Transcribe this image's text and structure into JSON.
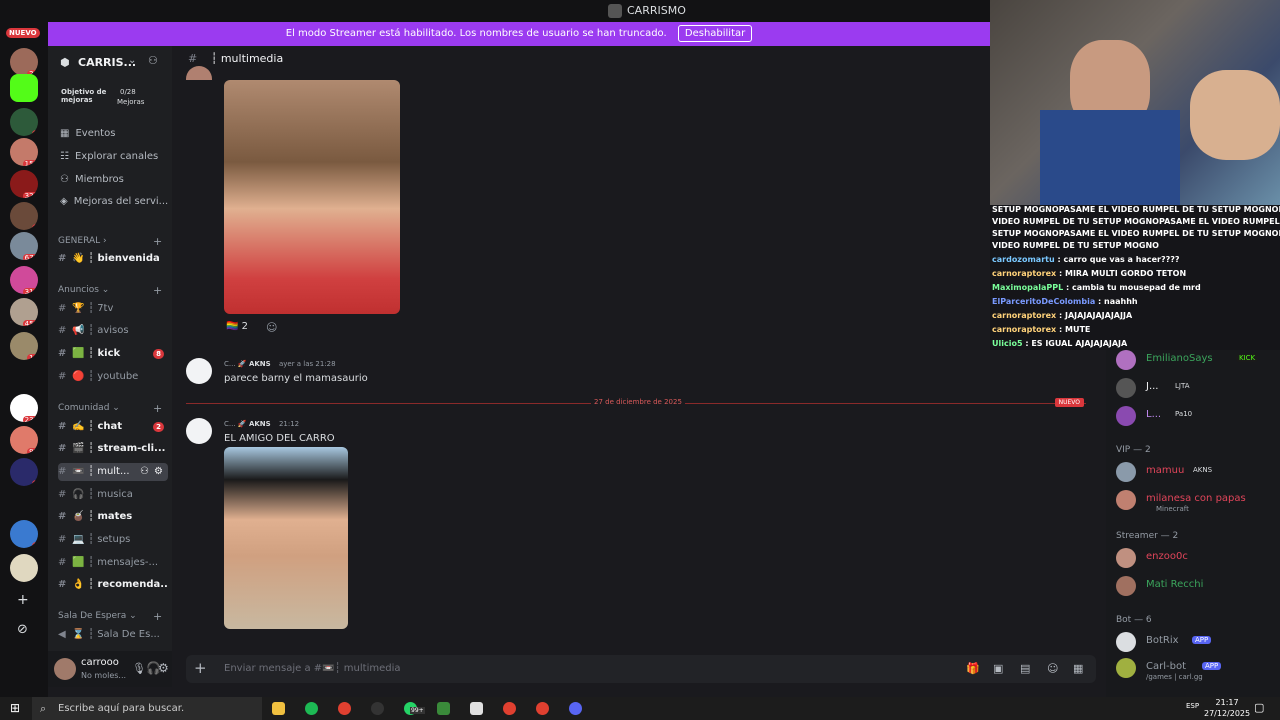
{
  "window": {
    "title": "CARRISMO"
  },
  "banner": {
    "text": "El modo Streamer está habilitado. Los nombres de usuario se han truncado.",
    "button": "Deshabilitar"
  },
  "rail": {
    "new_label": "NUEVO",
    "server_badges": [
      "26",
      "9",
      "152",
      "320",
      "1",
      "672",
      "318",
      "453",
      "10",
      "233",
      "97",
      "1",
      "2"
    ]
  },
  "sidebar": {
    "server_name": "CARRIS...",
    "boost": {
      "label": "Objetivo de mejoras",
      "count": "0/28",
      "unit": "Mejoras"
    },
    "menu": [
      "Eventos",
      "Explorar canales",
      "Miembros",
      "Mejoras del servi..."
    ],
    "categories": {
      "general": "GENERAL",
      "anuncios": "Anuncios",
      "comunidad": "Comunidad",
      "espera": "Sala De Espera"
    },
    "channels": {
      "bienvenida": {
        "emoji": "👋",
        "name": "┆ bienvenida"
      },
      "7tv": {
        "emoji": "🏆",
        "name": "┆ 7tv"
      },
      "avisos": {
        "emoji": "📢",
        "name": "┆ avisos"
      },
      "kick": {
        "emoji": "🟩",
        "name": "┆ kick",
        "badge": "8"
      },
      "youtube": {
        "emoji": "🔴",
        "name": "┆ youtube"
      },
      "chat": {
        "emoji": "✍️",
        "name": "┆ chat",
        "badge": "2"
      },
      "stream": {
        "emoji": "🎬",
        "name": "┆ stream-cli..."
      },
      "multimedia": {
        "emoji": "📼",
        "name": "┆ mult..."
      },
      "musica": {
        "emoji": "🎧",
        "name": "┆ musica"
      },
      "mates": {
        "emoji": "🧉",
        "name": "┆ mates"
      },
      "setups": {
        "emoji": "💻",
        "name": "┆ setups"
      },
      "mensajes": {
        "emoji": "🟩",
        "name": "┆ mensajes-..."
      },
      "recomenda": {
        "emoji": "👌",
        "name": "┆ recomenda..."
      },
      "sala": {
        "emoji": "⌛",
        "name": "┆ Sala De Es..."
      }
    },
    "user": {
      "name": "carrooo",
      "status": "No moles..."
    }
  },
  "chat": {
    "channel": "┆ multimedia",
    "reaction": {
      "emoji": "🏳️‍🌈",
      "count": "2"
    },
    "messages": [
      {
        "author": "C...",
        "tag": "AKNS",
        "time": "ayer a las 21:28",
        "text": "parece barny el mamasaurio"
      },
      {
        "author": "C...",
        "tag": "AKNS",
        "time": "21:12",
        "text": "EL AMIGO DEL CARRO"
      }
    ],
    "divider_date": "27 de diciembre de 2025",
    "new_label": "NUEVO",
    "composer_placeholder": "Enviar mensaje a #📼┆ multimedia"
  },
  "stream_chat": [
    {
      "user": "",
      "text": "SETUP MOGNOPASAME EL VIDEO RUMPEL DE TU SETUP MOGNOPASAME EL"
    },
    {
      "user": "",
      "text": "VIDEO RUMPEL DE TU SETUP MOGNOPASAME EL VIDEO RUMPEL DE TU"
    },
    {
      "user": "",
      "text": "SETUP MOGNOPASAME EL VIDEO RUMPEL DE TU SETUP MOGNOPASAME EL"
    },
    {
      "user": "",
      "text": "VIDEO RUMPEL DE TU SETUP MOGNO"
    },
    {
      "user": "cardozomartu",
      "text": ": carro que vas a hacer????"
    },
    {
      "user": "carnoraptorex",
      "text": ": MIRA MULTI GORDO TETON"
    },
    {
      "user": "MaximopalaPPL",
      "text": ": cambia tu mousepad de mrd"
    },
    {
      "user": "ElParceritoDeColombia",
      "text": ": naahhh"
    },
    {
      "user": "carnoraptorex",
      "text": ": JAJAJAJAJAJAJJA"
    },
    {
      "user": "carnoraptorex",
      "text": ": MUTE"
    },
    {
      "user": "Ulicio5",
      "text": ": ES IGUAL AJAJAJAJAJA"
    }
  ],
  "members": {
    "groups": {
      "vip": "VIP — 2",
      "streamer": "Streamer — 2",
      "bot": "Bot — 6"
    },
    "list": [
      {
        "name": "EmilianoSays",
        "tag": "KICK",
        "color": "#3ba55c"
      },
      {
        "name": "J...",
        "tag": "LJTA",
        "color": "#f2f3f5"
      },
      {
        "name": "L...",
        "tag": "Pa10",
        "color": "#c08af0"
      },
      {
        "name": "mamuu",
        "tag": "AKNS",
        "color": "#e0455a"
      },
      {
        "name": "milanesa con papas",
        "sub": "Minecraft",
        "color": "#e0455a"
      },
      {
        "name": "enzoo0c",
        "color": "#e0455a"
      },
      {
        "name": "Mati Recchi",
        "color": "#3ba55c"
      },
      {
        "name": "BotRix",
        "tag": "APP",
        "color": "#949ba4"
      },
      {
        "name": "Carl-bot",
        "tag": "APP",
        "sub": "/games | carl.gg",
        "color": "#949ba4"
      }
    ]
  },
  "taskbar": {
    "search": "Escribe aquí para buscar.",
    "time": "21:17",
    "date": "27/12/2025",
    "lang": "ESP",
    "badge": "99+"
  }
}
